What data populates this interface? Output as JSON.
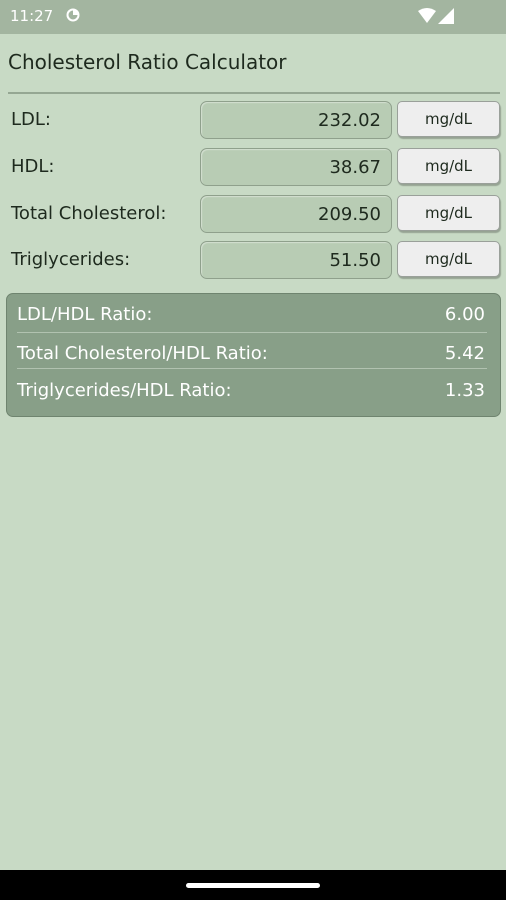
{
  "status_bar": {
    "time": "11:27",
    "icons": [
      "sync-icon",
      "wifi-icon",
      "signal-icon"
    ]
  },
  "app": {
    "title": "Cholesterol Ratio Calculator"
  },
  "inputs": [
    {
      "label": "LDL:",
      "value": "232.02",
      "unit": "mg/dL"
    },
    {
      "label": "HDL:",
      "value": "38.67",
      "unit": "mg/dL"
    },
    {
      "label": "Total Cholesterol:",
      "value": "209.50",
      "unit": "mg/dL"
    },
    {
      "label": "Triglycerides:",
      "value": "51.50",
      "unit": "mg/dL"
    }
  ],
  "results": [
    {
      "label": "LDL/HDL Ratio:",
      "value": "6.00"
    },
    {
      "label": "Total Cholesterol/HDL Ratio:",
      "value": "5.42"
    },
    {
      "label": "Triglycerides/HDL Ratio:",
      "value": "1.33"
    }
  ],
  "colors": {
    "background": "#c8dac5",
    "status_bar": "#a3b5a0",
    "field": "#b8ccb4",
    "results_panel": "#889f88",
    "button": "#eeeeee"
  }
}
